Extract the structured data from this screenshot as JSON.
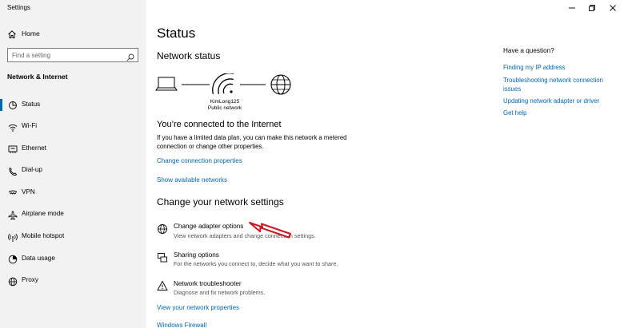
{
  "window": {
    "title": "Settings"
  },
  "sidebar": {
    "home_label": "Home",
    "search_placeholder": "Find a setting",
    "section_title": "Network & Internet",
    "items": [
      {
        "label": "Status",
        "icon": "home-status-icon",
        "active": true
      },
      {
        "label": "Wi-Fi",
        "icon": "wifi-icon"
      },
      {
        "label": "Ethernet",
        "icon": "ethernet-icon"
      },
      {
        "label": "Dial-up",
        "icon": "dial-up-icon"
      },
      {
        "label": "VPN",
        "icon": "vpn-icon"
      },
      {
        "label": "Airplane mode",
        "icon": "airplane-icon"
      },
      {
        "label": "Mobile hotspot",
        "icon": "hotspot-icon"
      },
      {
        "label": "Data usage",
        "icon": "data-usage-icon"
      },
      {
        "label": "Proxy",
        "icon": "globe-icon"
      }
    ]
  },
  "main": {
    "title": "Status",
    "network_status_heading": "Network status",
    "network_name": "KimLong125",
    "network_type": "Public network",
    "connected_text": "You’re connected to the Internet",
    "connected_desc": "If you have a limited data plan, you can make this network a metered connection or change other properties.",
    "change_connection_link": "Change connection properties",
    "show_networks_link": "Show available networks",
    "change_settings_heading": "Change your network settings",
    "options": [
      {
        "title": "Change adapter options",
        "desc": "View network adapters and change connection settings.",
        "icon": "adapter-globe-icon"
      },
      {
        "title": "Sharing options",
        "desc": "For the networks you connect to, decide what you want to share.",
        "icon": "sharing-icon"
      },
      {
        "title": "Network troubleshooter",
        "desc": "Diagnose and fix network problems.",
        "icon": "warning-icon"
      }
    ],
    "view_properties_link": "View your network properties",
    "firewall_link": "Windows Firewall"
  },
  "right_panel": {
    "title": "Have a question?",
    "links": [
      "Finding my IP address",
      "Troubleshooting network connection issues",
      "Updating network adapter or driver",
      "Get help"
    ]
  },
  "colors": {
    "accent": "#0067b8",
    "annotation_arrow": "#d0151c",
    "sidebar_bg": "#f2f2f2"
  }
}
